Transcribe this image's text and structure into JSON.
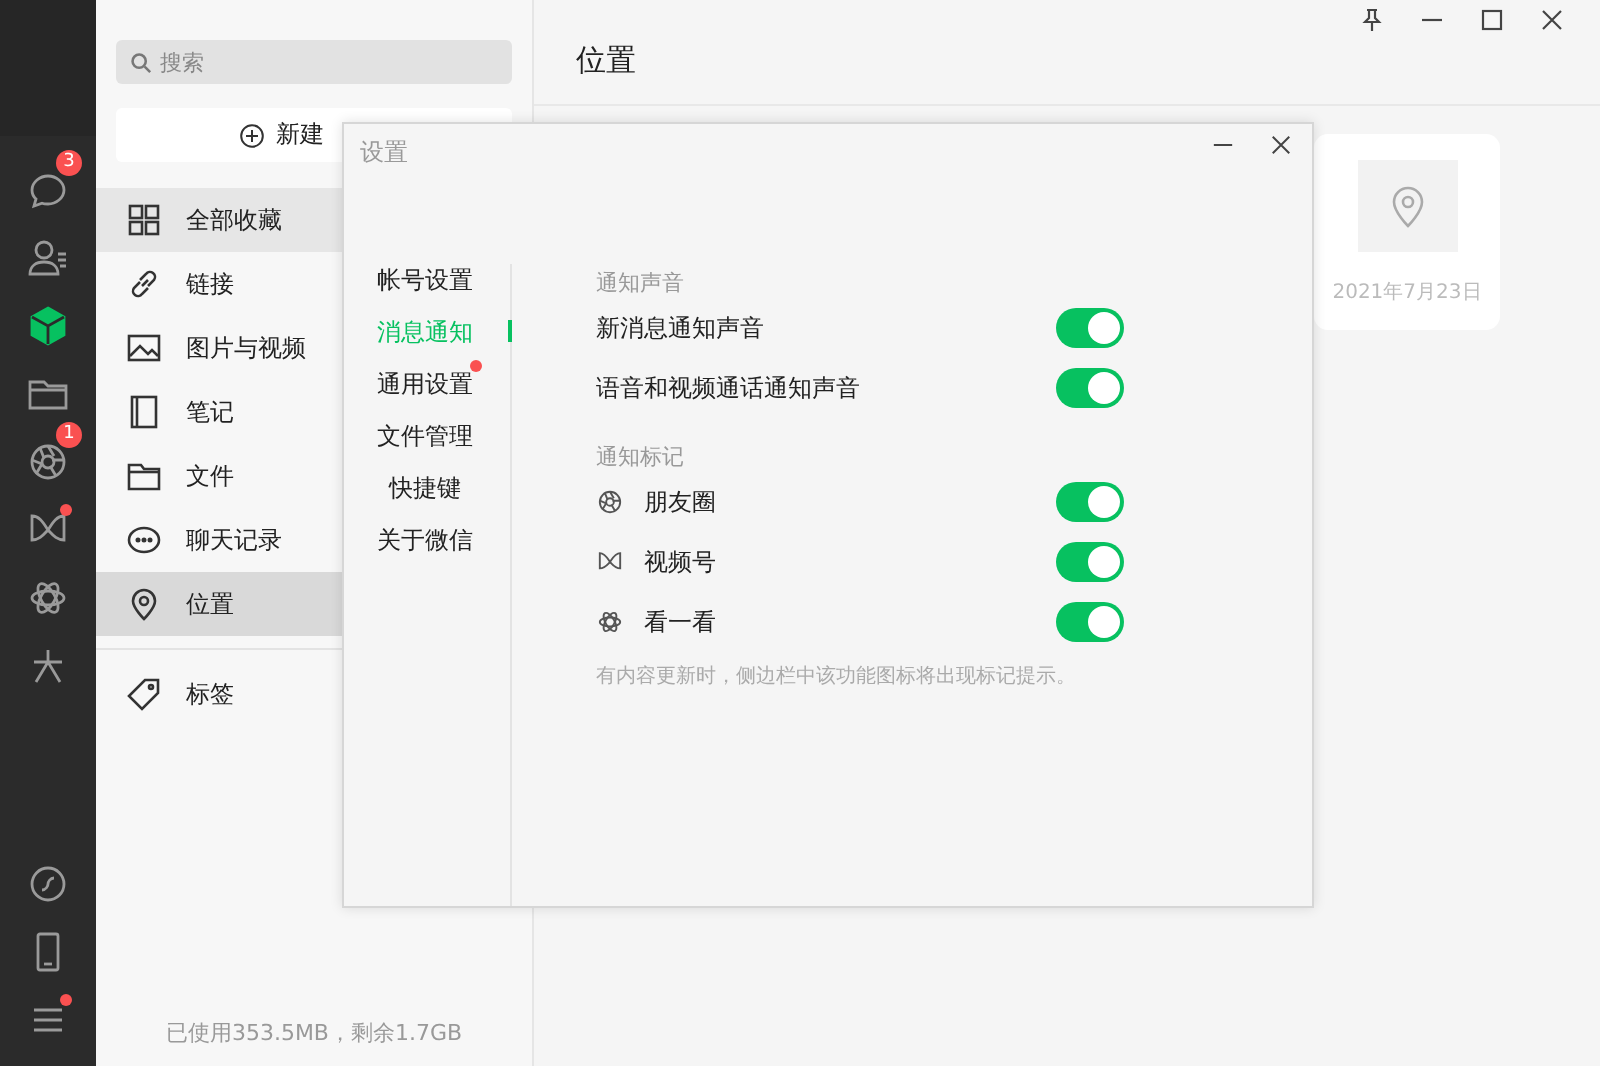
{
  "rail": {
    "top_items": [
      {
        "badge": "3",
        "dot": false,
        "selected": false
      },
      {
        "dot": false,
        "selected": false
      },
      {
        "dot": false,
        "selected": true
      },
      {
        "dot": false,
        "selected": false
      },
      {
        "badge": "1",
        "dot": false,
        "selected": false
      },
      {
        "dot": true,
        "selected": false
      },
      {
        "dot": false,
        "selected": false
      },
      {
        "dot": false,
        "selected": false
      }
    ],
    "bottom_items": [
      {
        "dot": false
      },
      {
        "dot": false
      },
      {
        "dot": true
      }
    ]
  },
  "favorites": {
    "search": {
      "placeholder": "搜索"
    },
    "new_button": "新建",
    "items": [
      {
        "label": "全部收藏",
        "selected": false,
        "highlighted": true
      },
      {
        "label": "链接",
        "selected": false,
        "highlighted": false
      },
      {
        "label": "图片与视频",
        "selected": false,
        "highlighted": false
      },
      {
        "label": "笔记",
        "selected": false,
        "highlighted": false
      },
      {
        "label": "文件",
        "selected": false,
        "highlighted": false
      },
      {
        "label": "聊天记录",
        "selected": false,
        "highlighted": false
      },
      {
        "label": "位置",
        "selected": true,
        "highlighted": false
      }
    ],
    "tags": [
      {
        "label": "标签",
        "selected": false,
        "highlighted": false
      }
    ],
    "storage": "已使用353.5MB，剩余1.7GB"
  },
  "content": {
    "title": "位置",
    "cards": [
      {
        "date": "2021年7月23日"
      }
    ]
  },
  "settings": {
    "title": "设置",
    "nav": [
      {
        "label": "帐号设置",
        "selected": false,
        "dot": false
      },
      {
        "label": "消息通知",
        "selected": true,
        "dot": false
      },
      {
        "label": "通用设置",
        "selected": false,
        "dot": true
      },
      {
        "label": "文件管理",
        "selected": false,
        "dot": false
      },
      {
        "label": "快捷键",
        "selected": false,
        "dot": false
      },
      {
        "label": "关于微信",
        "selected": false,
        "dot": false
      }
    ],
    "sections": [
      {
        "heading": "通知声音",
        "rows": [
          {
            "label": "新消息通知声音",
            "on": true
          },
          {
            "label": "语音和视频通话通知声音",
            "on": true
          }
        ]
      },
      {
        "heading": "通知标记",
        "rows": [
          {
            "label": "朋友圈",
            "on": true,
            "kind": "icon"
          },
          {
            "label": "视频号",
            "on": true,
            "kind": "icon"
          },
          {
            "label": "看一看",
            "on": true,
            "kind": "icon"
          }
        ],
        "hint": "有内容更新时，侧边栏中该功能图标将出现标记提示。"
      }
    ]
  }
}
